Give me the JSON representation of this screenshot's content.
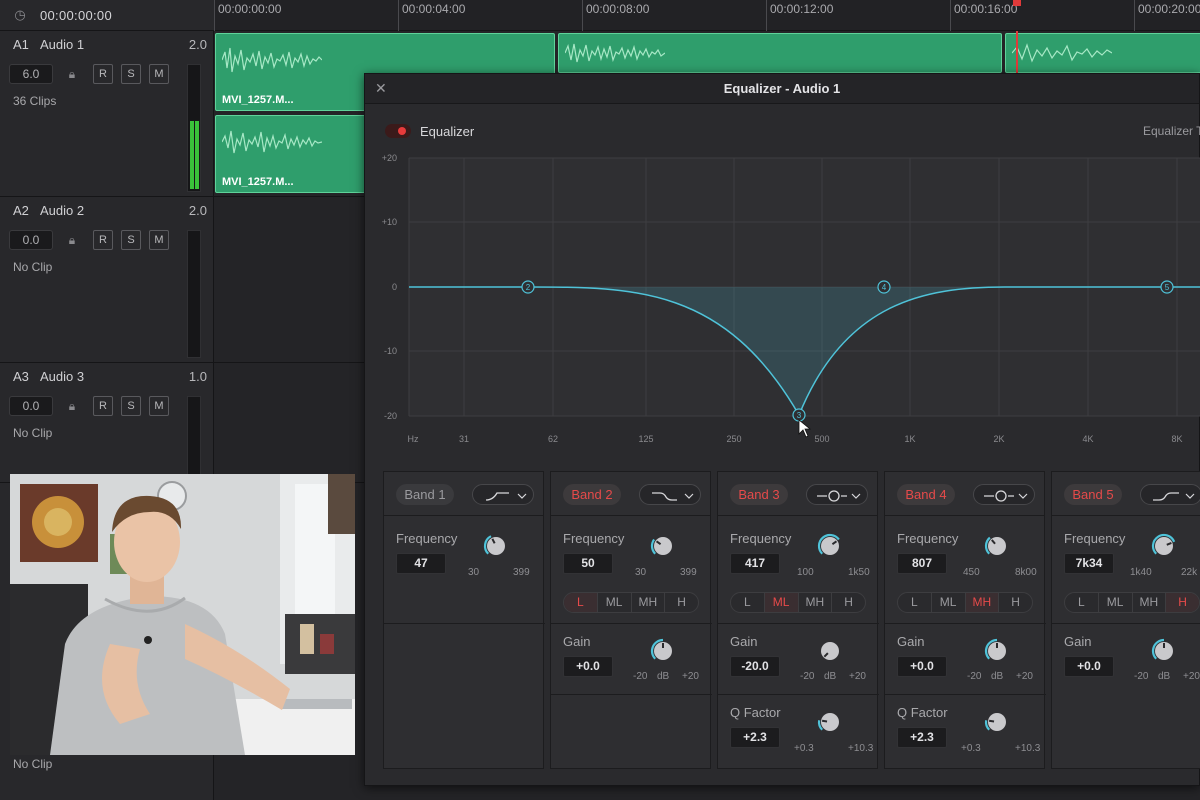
{
  "header": {
    "timecode": "00:00:00:00",
    "ruler_marks": [
      "00:00:00:00",
      "00:00:04:00",
      "00:00:08:00",
      "00:00:12:00",
      "00:00:16:00",
      "00:00:20:00"
    ]
  },
  "tracks": [
    {
      "id": "A1",
      "name": "Audio 1",
      "value": "2.0",
      "volume": "6.0",
      "info": "36 Clips",
      "buttons": [
        "R",
        "S",
        "M"
      ]
    },
    {
      "id": "A2",
      "name": "Audio 2",
      "value": "2.0",
      "volume": "0.0",
      "info": "No Clip",
      "buttons": [
        "R",
        "S",
        "M"
      ]
    },
    {
      "id": "A3",
      "name": "Audio 3",
      "value": "1.0",
      "volume": "0.0",
      "info": "No Clip",
      "buttons": [
        "R",
        "S",
        "M"
      ]
    }
  ],
  "track4_info": "No Clip",
  "clips": {
    "name": "MVI_1257.M..."
  },
  "eq": {
    "title": "Equalizer - Audio 1",
    "enable_label": "Equalizer",
    "type_label": "Equalizer Type",
    "y_ticks": [
      "+20",
      "+10",
      "0",
      "-10",
      "-20"
    ],
    "x_ticks": [
      "Hz",
      "31",
      "62",
      "125",
      "250",
      "500",
      "1K",
      "2K",
      "4K",
      "8K"
    ],
    "nodes": [
      "2",
      "3",
      "4",
      "5"
    ],
    "bands": [
      {
        "name": "Band 1",
        "enabled": false,
        "freq_label": "Frequency",
        "freq": "47",
        "freq_min": "30",
        "freq_max": "399",
        "freq_level": 0.4
      },
      {
        "name": "Band 2",
        "enabled": true,
        "freq_label": "Frequency",
        "freq": "50",
        "freq_min": "30",
        "freq_max": "399",
        "freq_level": 0.3,
        "lmh": [
          "L",
          "ML",
          "MH",
          "H"
        ],
        "lmh_active": 0,
        "gain_label": "Gain",
        "gain": "+0.0",
        "gain_min": "-20",
        "gain_unit": "dB",
        "gain_max": "+20",
        "gain_level": 0.5
      },
      {
        "name": "Band 3",
        "enabled": true,
        "freq_label": "Frequency",
        "freq": "417",
        "freq_min": "100",
        "freq_max": "1k50",
        "freq_level": 0.7,
        "lmh": [
          "L",
          "ML",
          "MH",
          "H"
        ],
        "lmh_active": 1,
        "gain_label": "Gain",
        "gain": "-20.0",
        "gain_min": "-20",
        "gain_unit": "dB",
        "gain_max": "+20",
        "gain_level": 0.0,
        "q_label": "Q Factor",
        "q": "+2.3",
        "q_min": "+0.3",
        "q_max": "+10.3",
        "q_level": 0.2
      },
      {
        "name": "Band 4",
        "enabled": true,
        "freq_label": "Frequency",
        "freq": "807",
        "freq_min": "450",
        "freq_max": "8k00",
        "freq_level": 0.35,
        "lmh": [
          "L",
          "ML",
          "MH",
          "H"
        ],
        "lmh_active": 2,
        "gain_label": "Gain",
        "gain": "+0.0",
        "gain_min": "-20",
        "gain_unit": "dB",
        "gain_max": "+20",
        "gain_level": 0.5,
        "q_label": "Q Factor",
        "q": "+2.3",
        "q_min": "+0.3",
        "q_max": "+10.3",
        "q_level": 0.2
      },
      {
        "name": "Band 5",
        "enabled": true,
        "freq_label": "Frequency",
        "freq": "7k34",
        "freq_min": "1k40",
        "freq_max": "22k",
        "freq_level": 0.75,
        "lmh": [
          "L",
          "ML",
          "MH",
          "H"
        ],
        "lmh_active": 3,
        "gain_label": "Gain",
        "gain": "+0.0",
        "gain_min": "-20",
        "gain_unit": "dB",
        "gain_max": "+20",
        "gain_level": 0.5
      }
    ]
  },
  "colors": {
    "accent": "#e64a4a",
    "clip": "#2f9e6c",
    "curve": "#4fc3d9",
    "meter": "#3ac23a"
  }
}
